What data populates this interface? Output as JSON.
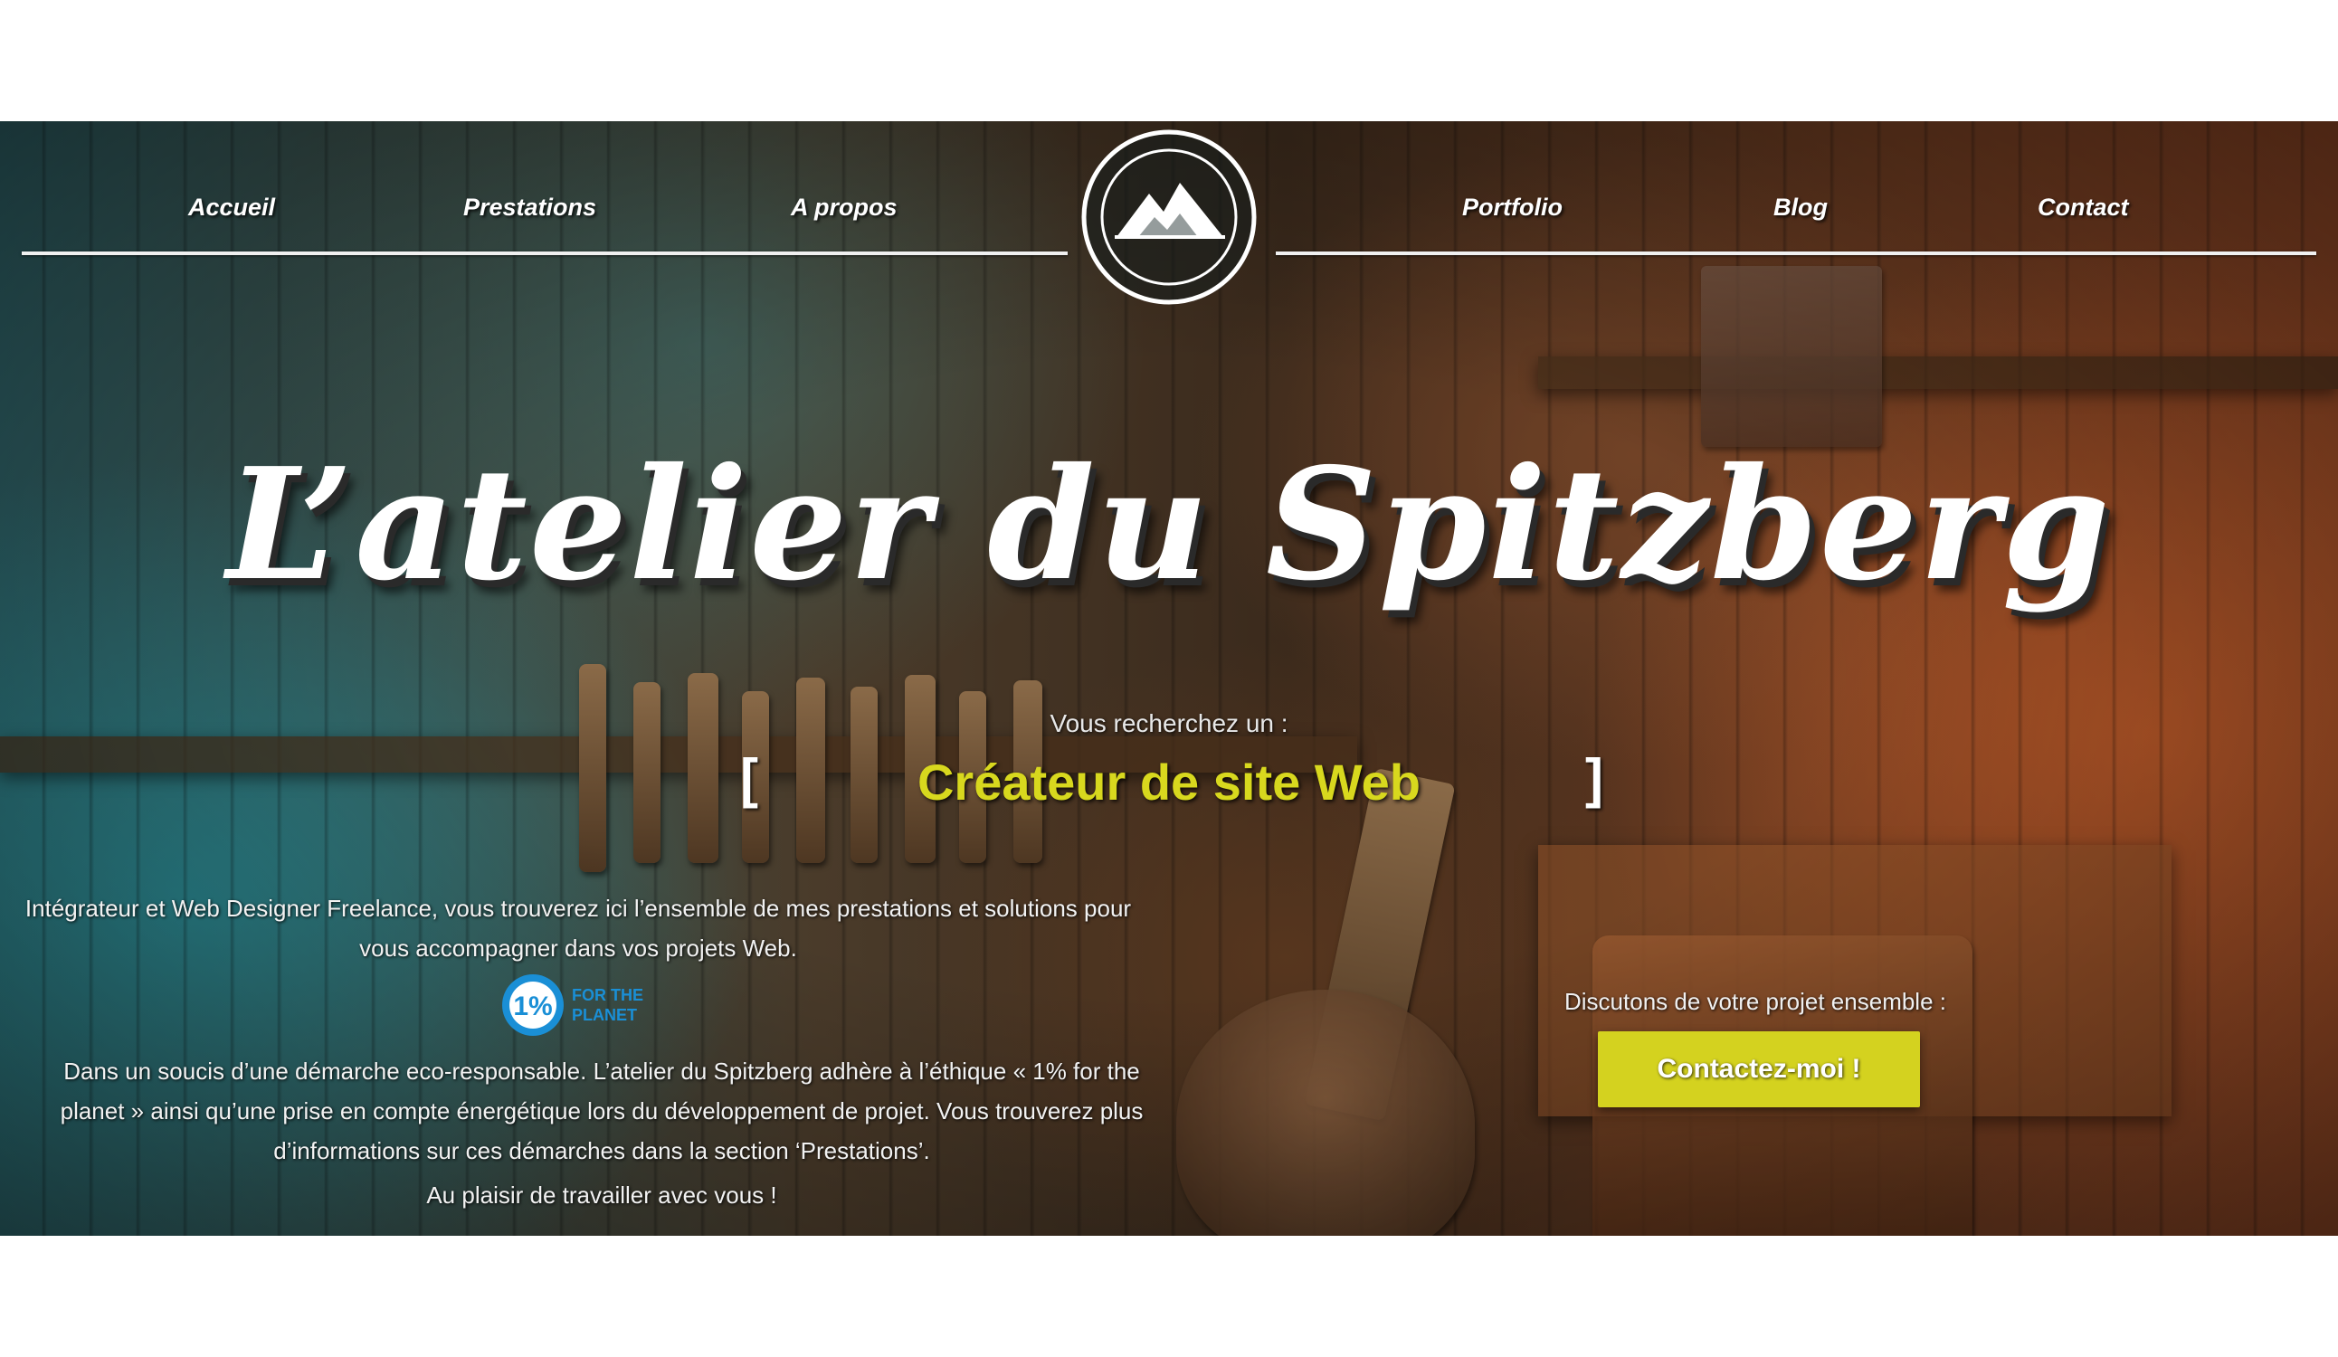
{
  "nav": {
    "items": [
      {
        "label": "Accueil"
      },
      {
        "label": "Prestations"
      },
      {
        "label": "A propos"
      },
      {
        "label": "Portfolio"
      },
      {
        "label": "Blog"
      },
      {
        "label": "Contact"
      }
    ],
    "logo_icon": "mountain-logo-icon"
  },
  "hero": {
    "title": "L’atelier du Spitzberg",
    "search_label": "Vous recherchez un :",
    "bracket_open": "[",
    "bracket_close": "]",
    "typed_text": "Créateur de site Web",
    "intro": "Intégrateur et Web Designer Freelance, vous trouverez ici l’ensemble de mes prestations et solutions pour vous accompagner dans vos projets Web.",
    "badge": {
      "number": "1%",
      "text_line1": "FOR THE",
      "text_line2": "PLANET"
    },
    "eco": "Dans un soucis d’une démarche eco-responsable. L’atelier du Spitzberg adhère à l’éthique « 1% for the planet » ainsi qu’une prise en compte énergétique lors du développement de projet. Vous trouverez plus d’informations sur ces démarches dans la section ‘Prestations’.",
    "thanks": "Au plaisir de travailler avec vous !",
    "cta_label": "Discutons de votre projet ensemble :",
    "cta_button": "Contactez-moi !"
  },
  "colors": {
    "accent_yellow": "#d4d21f",
    "typed_text": "#d8d81e",
    "nav_line": "#f0f0f0",
    "badge_blue": "#1a8fd6"
  }
}
